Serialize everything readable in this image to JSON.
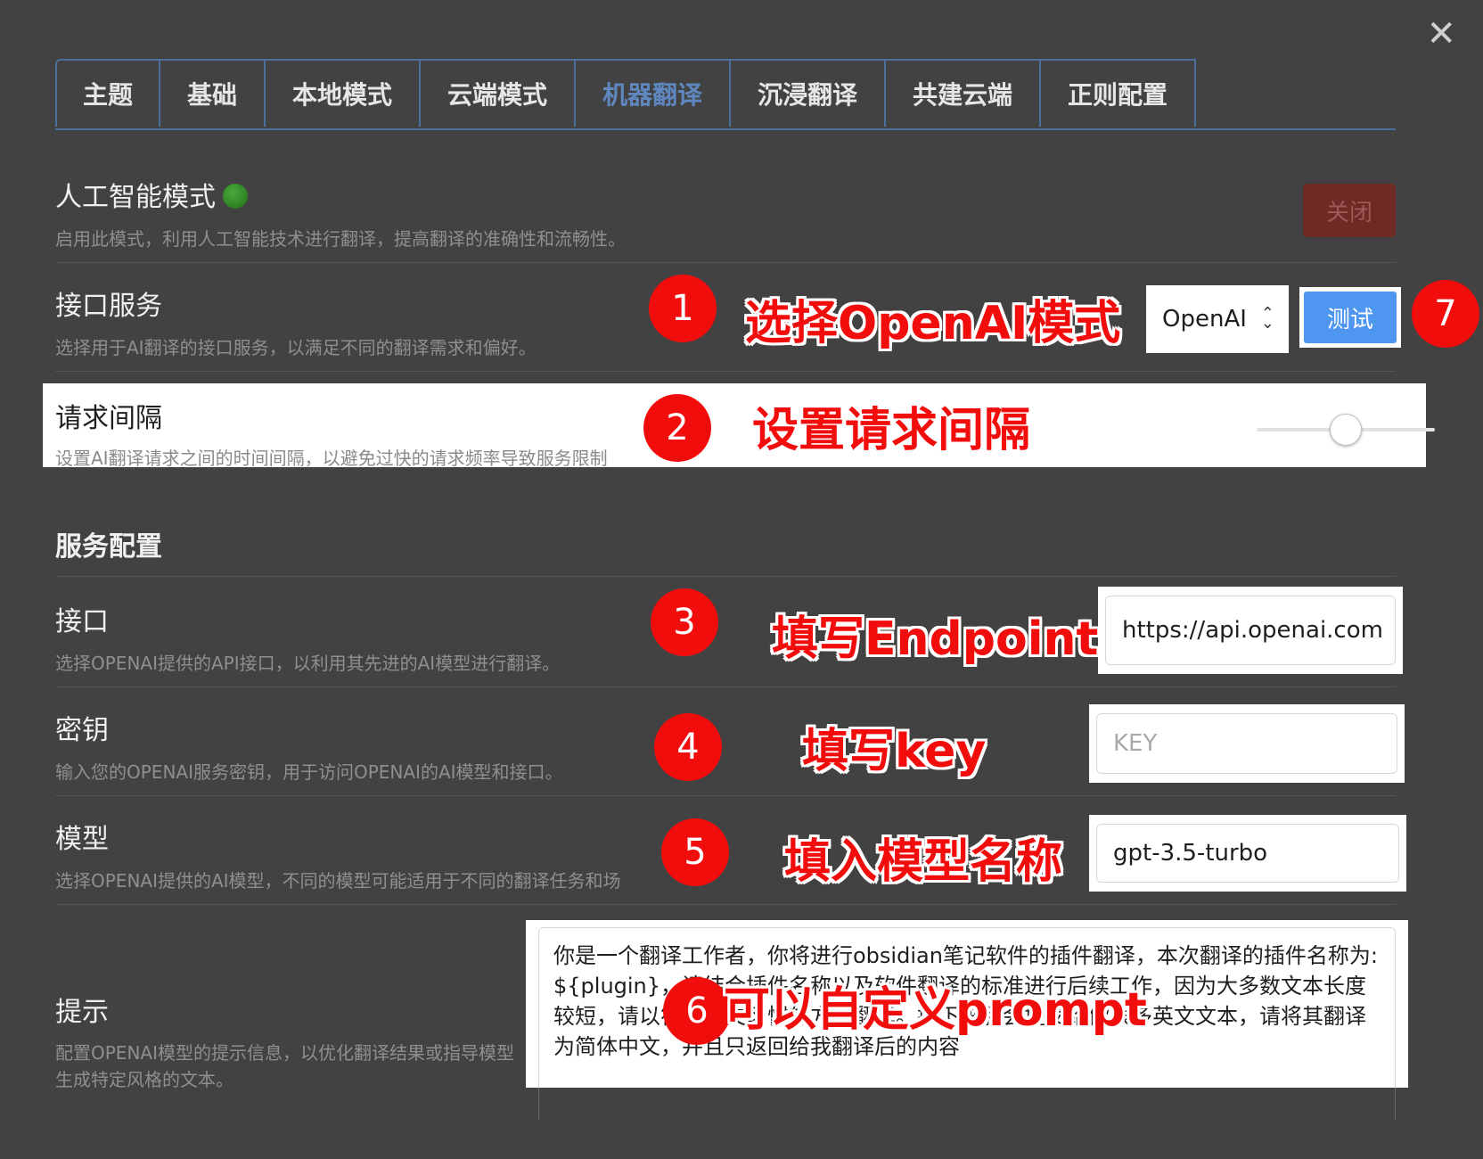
{
  "window": {
    "close_glyph": "✕"
  },
  "tabs": [
    {
      "label": "主题",
      "active": false
    },
    {
      "label": "基础",
      "active": false
    },
    {
      "label": "本地模式",
      "active": false
    },
    {
      "label": "云端模式",
      "active": false
    },
    {
      "label": "机器翻译",
      "active": true
    },
    {
      "label": "沉浸翻译",
      "active": false
    },
    {
      "label": "共建云端",
      "active": false
    },
    {
      "label": "正则配置",
      "active": false
    }
  ],
  "ai_mode": {
    "title": "人工智能模式",
    "desc": "启用此模式，利用人工智能技术进行翻译，提高翻译的准确性和流畅性。",
    "status_color": "#2e8b22",
    "button_label": "关闭"
  },
  "api_service": {
    "title": "接口服务",
    "desc": "选择用于AI翻译的接口服务，以满足不同的翻译需求和偏好。",
    "selected": "OpenAI",
    "test_label": "测试"
  },
  "interval": {
    "title": "请求间隔",
    "desc": "设置AI翻译请求之间的时间间隔，以避免过快的请求频率导致服务限制",
    "slider_level": 0.5
  },
  "service_config": {
    "title": "服务配置",
    "endpoint": {
      "title": "接口",
      "desc": "选择OPENAI提供的API接口，以利用其先进的AI模型进行翻译。",
      "value": "https://api.openai.com"
    },
    "key": {
      "title": "密钥",
      "desc": "输入您的OPENAI服务密钥，用于访问OPENAI的AI模型和接口。",
      "placeholder": "KEY"
    },
    "model": {
      "title": "模型",
      "desc": "选择OPENAI提供的AI模型，不同的模型可能适用于不同的翻译任务和场",
      "value": "gpt-3.5-turbo"
    },
    "prompt": {
      "title": "提示",
      "desc": "配置OPENAI模型的提示信息，以优化翻译结果或指导模型生成特定风格的文本。",
      "value": "你是一个翻译工作者，你将进行obsidian笔记软件的插件翻译，本次翻译的插件名称为: ${plugin}，请结合插件名称以及软件翻译的标准进行后续工作，因为大多数文本长度较短，请以符合中文习惯的方式翻译。接下来我会提交给你很多英文文本，请将其翻译为简体中文，并且只返回给我翻译后的内容"
    }
  },
  "annotations": [
    {
      "num": "1",
      "text": "选择OpenAI模式"
    },
    {
      "num": "2",
      "text": "设置请求间隔"
    },
    {
      "num": "3",
      "text": "填写Endpoint"
    },
    {
      "num": "4",
      "text": "填写key"
    },
    {
      "num": "5",
      "text": "填入模型名称"
    },
    {
      "num": "6",
      "text": "可以自定义prompt"
    },
    {
      "num": "7",
      "text": ""
    }
  ],
  "colors": {
    "accent_blue": "#4f96f1",
    "annotation_red": "#f20d0d",
    "off_button": "#6f2a26"
  }
}
